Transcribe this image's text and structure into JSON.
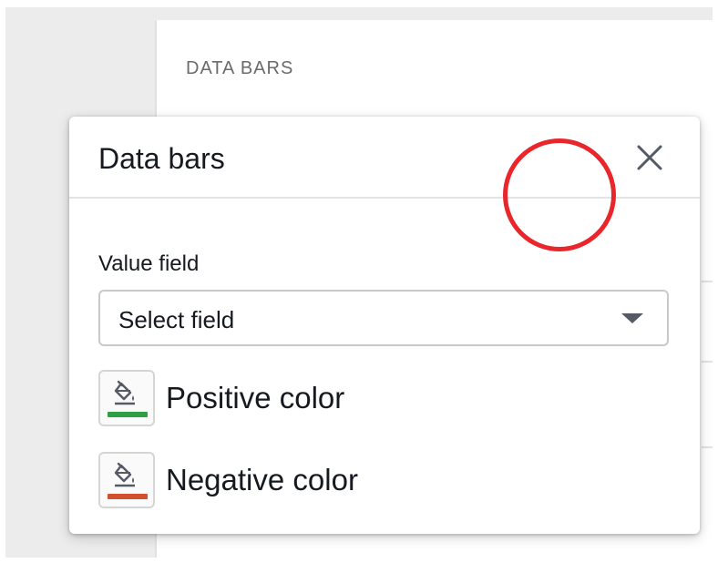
{
  "background": {
    "section_label": "DATA BARS"
  },
  "dialog": {
    "title": "Data bars",
    "close_icon": "close-icon",
    "value_field": {
      "label": "Value field",
      "selected": "Select field",
      "icon": "caret-down-icon"
    },
    "positive": {
      "label": "Positive color",
      "color": "#2ea043",
      "icon": "paint-bucket-icon"
    },
    "negative": {
      "label": "Negative color",
      "color": "#d1502d",
      "icon": "paint-bucket-icon"
    }
  },
  "annotation": {
    "ring_color": "#e8262c"
  }
}
